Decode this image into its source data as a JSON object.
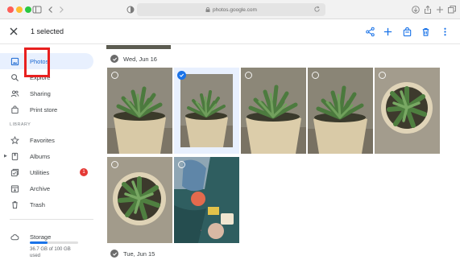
{
  "browser": {
    "url": "photos.google.com"
  },
  "appbar": {
    "selected_label": "1 selected"
  },
  "sidebar": {
    "items": [
      {
        "label": "Photos",
        "icon": "photos-icon",
        "active": true
      },
      {
        "label": "Explore",
        "icon": "search-icon"
      },
      {
        "label": "Sharing",
        "icon": "people-icon"
      },
      {
        "label": "Print store",
        "icon": "print-store-icon"
      }
    ],
    "library_label": "LIBRARY",
    "library_items": [
      {
        "label": "Favorites",
        "icon": "star-icon"
      },
      {
        "label": "Albums",
        "icon": "album-icon"
      },
      {
        "label": "Utilities",
        "icon": "utilities-icon",
        "badge": "1"
      },
      {
        "label": "Archive",
        "icon": "archive-icon"
      },
      {
        "label": "Trash",
        "icon": "trash-icon"
      }
    ],
    "storage": {
      "label": "Storage",
      "used_fraction": 0.37,
      "usage_text": "36.7 GB of 100 GB",
      "usage_suffix": "used"
    }
  },
  "main": {
    "groups": [
      {
        "date": "Wed, Jun 16"
      },
      {
        "date": "Tue, Jun 15"
      }
    ]
  },
  "colors": {
    "accent": "#1a73e8",
    "highlight_box": "#e8201f",
    "badge": "#e53935"
  }
}
